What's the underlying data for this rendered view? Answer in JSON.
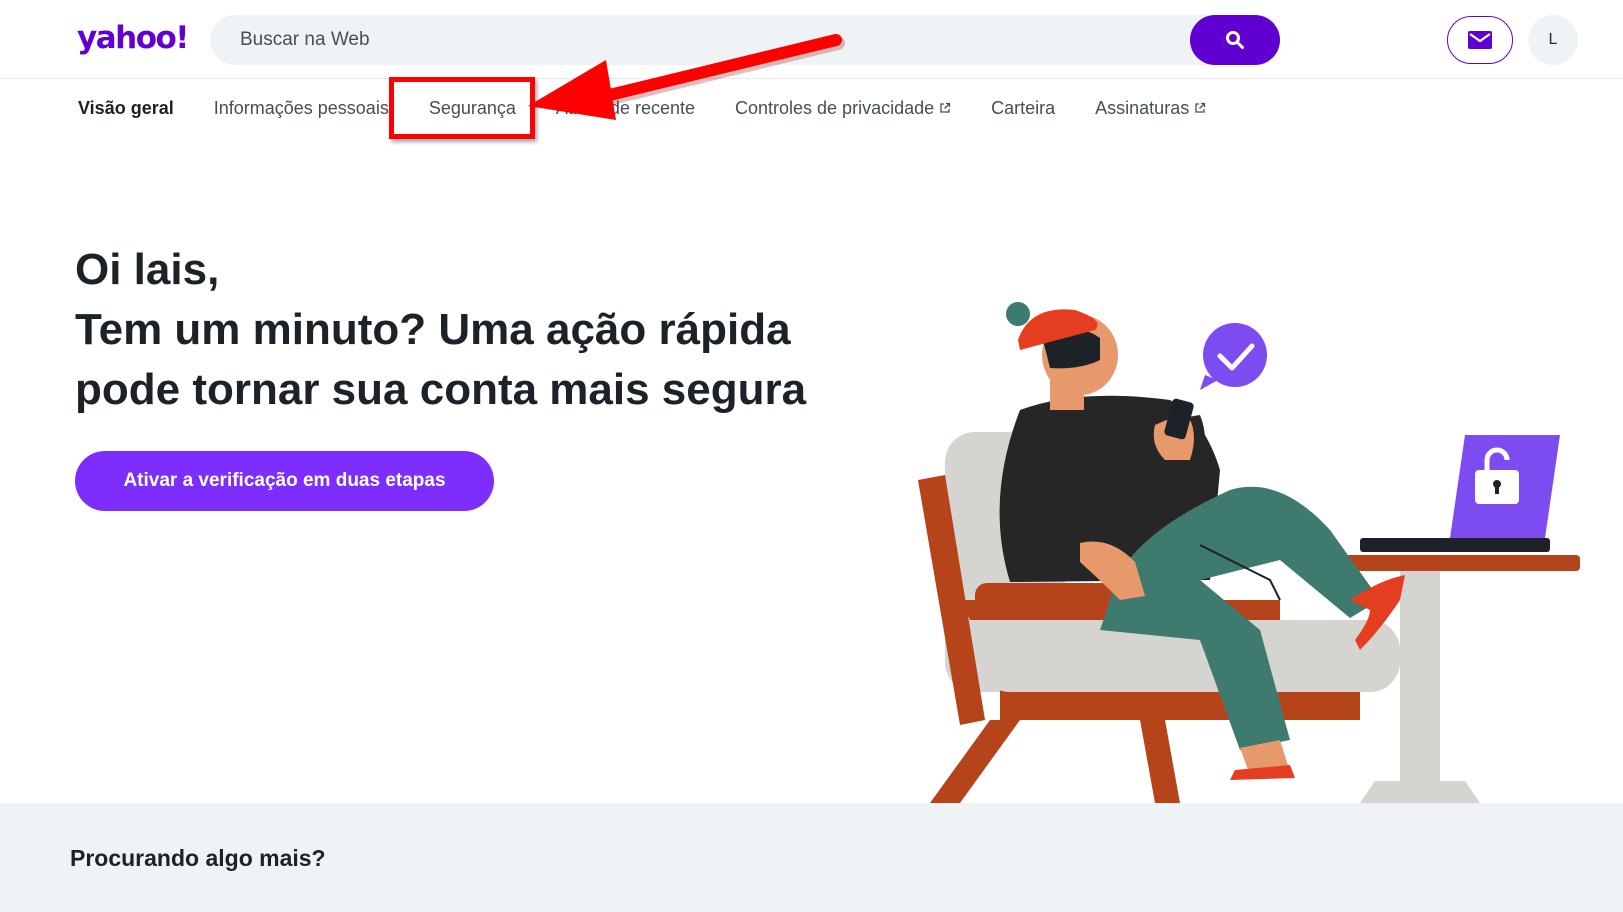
{
  "header": {
    "logo": "yahoo!",
    "search_placeholder": "Buscar na Web",
    "avatar_letter": "L"
  },
  "nav": {
    "items": [
      "Visão geral",
      "Informações pessoais",
      "Segurança",
      "Atividade recente",
      "Controles de privacidade",
      "Carteira",
      "Assinaturas"
    ]
  },
  "hero": {
    "line1": "Oi lais,",
    "line2": "Tem um minuto? Uma ação rápida",
    "line3": "pode tornar sua conta mais segura",
    "cta_label": "Ativar a verificação em duas etapas"
  },
  "footer": {
    "title": "Procurando algo mais?"
  },
  "colors": {
    "brand": "#6001d2",
    "cta": "#7d2eff",
    "annotation": "#ff0000"
  }
}
